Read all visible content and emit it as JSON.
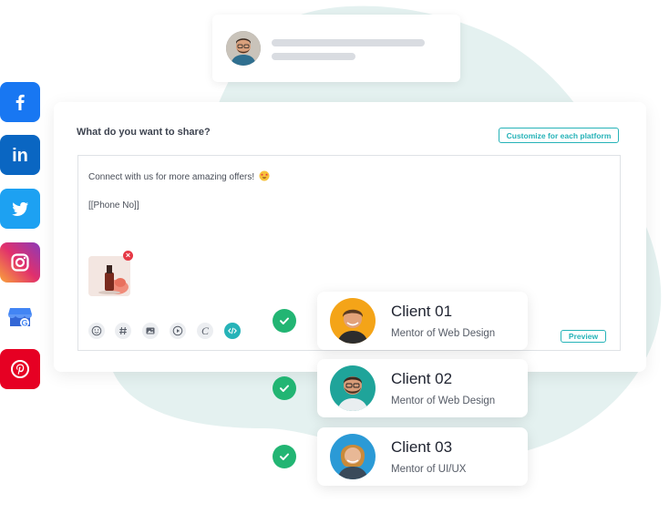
{
  "colors": {
    "accent": "#26b3b8",
    "check": "#22b573",
    "blob": "#e4f1f0"
  },
  "top_card": {
    "avatar_icon": "profile-avatar"
  },
  "social_icons": [
    {
      "name": "facebook-icon",
      "glyph": "f",
      "color": "#1877f2"
    },
    {
      "name": "linkedin-icon",
      "glyph": "in",
      "color": "#0a66c2"
    },
    {
      "name": "twitter-icon",
      "glyph": "bird",
      "color": "#1da1f2"
    },
    {
      "name": "instagram-icon",
      "glyph": "camera",
      "color": "#e1306c"
    },
    {
      "name": "google-business-icon",
      "glyph": "store",
      "color": "#4285f4"
    },
    {
      "name": "pinterest-icon",
      "glyph": "p",
      "color": "#e60023"
    }
  ],
  "composer": {
    "title": "What do you want to share?",
    "customize_label": "Customize for each platform",
    "message_line1": "Connect with us for more amazing offers!",
    "message_line2": "[[Phone No]]",
    "preview_label": "Preview",
    "tools": [
      "emoji-icon",
      "hashtag-icon",
      "image-icon",
      "video-icon",
      "canva-icon",
      "code-icon"
    ]
  },
  "clients": [
    {
      "name": "Client 01",
      "role": "Mentor of Web Design"
    },
    {
      "name": "Client 02",
      "role": "Mentor of Web Design"
    },
    {
      "name": "Client 03",
      "role": "Mentor of UI/UX"
    }
  ]
}
